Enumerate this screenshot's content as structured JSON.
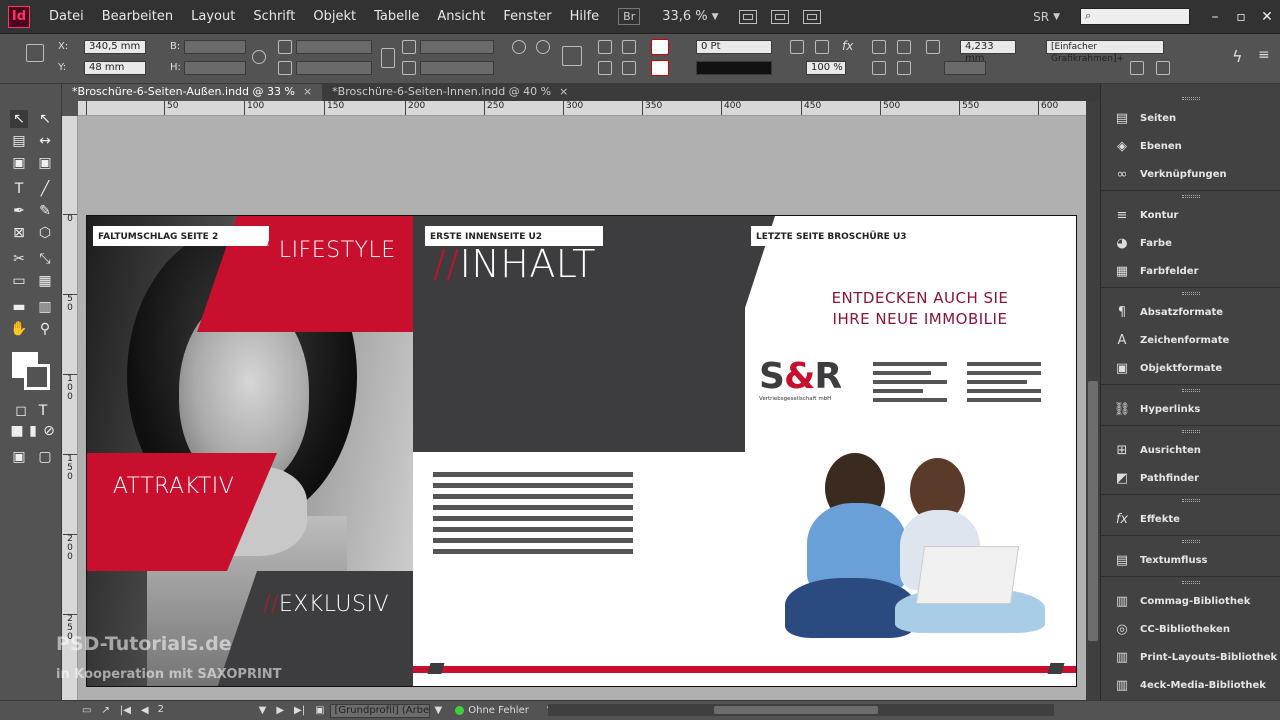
{
  "app": {
    "logo": "Id"
  },
  "menu": [
    "Datei",
    "Bearbeiten",
    "Layout",
    "Schrift",
    "Objekt",
    "Tabelle",
    "Ansicht",
    "Fenster",
    "Hilfe"
  ],
  "toolbar": {
    "bridge": "Br",
    "zoom": "33,6 %",
    "user": "SR"
  },
  "control": {
    "x_label": "X:",
    "x_value": "340,5 mm",
    "y_label": "Y:",
    "y_value": "48 mm",
    "b_label": "B:",
    "h_label": "H:",
    "stroke_weight": "0 Pt",
    "opacity": "100 %",
    "offset": "4,233 mm",
    "frame_style": "[Einfacher Grafikrahmen]+"
  },
  "tabs": [
    {
      "label": "*Broschüre-6-Seiten-Außen.indd @ 33 %",
      "close": "×"
    },
    {
      "label": "*Broschüre-6-Seiten-Innen.indd @ 40 %",
      "close": "×"
    }
  ],
  "ruler": {
    "h": [
      "50",
      "100",
      "150",
      "200",
      "250",
      "300",
      "350",
      "400",
      "450",
      "500",
      "550",
      "600"
    ],
    "v": [
      "0",
      "5 0",
      "1 0 0",
      "1 5 0",
      "2 0 0",
      "2 5 0"
    ]
  },
  "spread": {
    "page1": {
      "label": "FALTUMSCHLAG SEITE 2",
      "slogan1": "LIFESTYLE",
      "slogan2": "ATTRAKTIV",
      "slogan3": "EXKLUSIV",
      "slash": "//"
    },
    "page2": {
      "label": "ERSTE INNENSEITE U2",
      "title": "INHALT",
      "slash": "//"
    },
    "page3": {
      "label": "LETZTE SEITE BROSCHÜRE U3",
      "headline1": "ENTDECKEN AUCH SIE",
      "headline2": "IHRE NEUE IMMOBILIE",
      "logo_s": "S",
      "logo_amp": "&",
      "logo_r": "R",
      "logo_sub": "Vertriebsgesellschaft mbH"
    }
  },
  "watermark": {
    "line1": "PSD-Tutorials.de",
    "line2": "in Kooperation mit SAXOPRINT"
  },
  "panels": [
    {
      "group": 1,
      "label": "Seiten",
      "icon": "pages-icon"
    },
    {
      "group": 1,
      "label": "Ebenen",
      "icon": "layers-icon"
    },
    {
      "group": 1,
      "label": "Verknüpfungen",
      "icon": "links-icon"
    },
    {
      "group": 2,
      "label": "Kontur",
      "icon": "stroke-icon"
    },
    {
      "group": 2,
      "label": "Farbe",
      "icon": "color-icon"
    },
    {
      "group": 2,
      "label": "Farbfelder",
      "icon": "swatches-icon"
    },
    {
      "group": 3,
      "label": "Absatzformate",
      "icon": "paragraph-styles-icon"
    },
    {
      "group": 3,
      "label": "Zeichenformate",
      "icon": "character-styles-icon"
    },
    {
      "group": 3,
      "label": "Objektformate",
      "icon": "object-styles-icon"
    },
    {
      "group": 4,
      "label": "Hyperlinks",
      "icon": "hyperlinks-icon"
    },
    {
      "group": 5,
      "label": "Ausrichten",
      "icon": "align-icon"
    },
    {
      "group": 5,
      "label": "Pathfinder",
      "icon": "pathfinder-icon"
    },
    {
      "group": 6,
      "label": "Effekte",
      "icon": "effects-icon"
    },
    {
      "group": 7,
      "label": "Textumfluss",
      "icon": "text-wrap-icon"
    },
    {
      "group": 8,
      "label": "Commag-Bibliothek",
      "icon": "library-icon"
    },
    {
      "group": 8,
      "label": "CC-Bibliotheken",
      "icon": "cc-libraries-icon"
    },
    {
      "group": 8,
      "label": "Print-Layouts-Bibliothek",
      "icon": "library-icon"
    },
    {
      "group": 8,
      "label": "4eck-Media-Bibliothek",
      "icon": "library-icon"
    }
  ],
  "status": {
    "page": "2",
    "profile": "[Grundprofil] (Arbeits...",
    "preflight": "Ohne Fehler"
  },
  "colors": {
    "accent_red": "#c8102e",
    "dark_gray": "#3d3d3f",
    "headline_purple": "#8a1538",
    "app_magenta": "#ff3366"
  }
}
